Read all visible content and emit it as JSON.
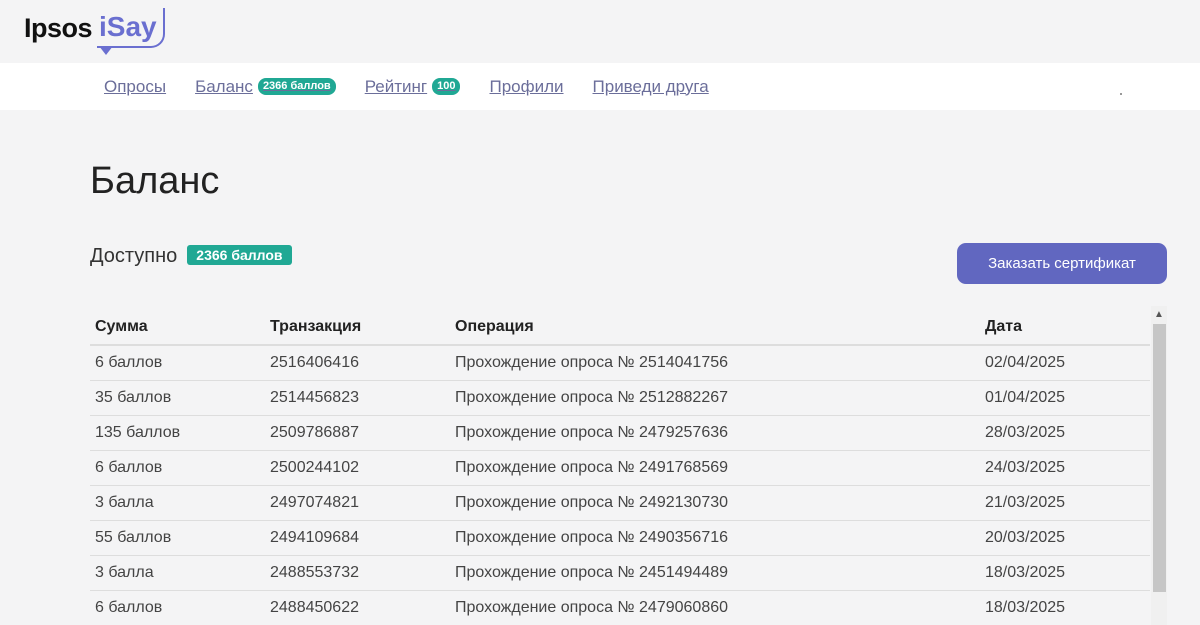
{
  "logo": {
    "brand": "Ipsos",
    "product": "iSay"
  },
  "nav": {
    "surveys": "Опросы",
    "balance": "Баланс",
    "balance_badge": "2366 баллов",
    "rating": "Рейтинг",
    "rating_badge": "100",
    "profiles": "Профили",
    "invite": "Приведи друга"
  },
  "page": {
    "title": "Баланс",
    "available_label": "Доступно",
    "available_badge": "2366 баллов",
    "cert_button": "Заказать сертификат"
  },
  "table": {
    "headers": [
      "Сумма",
      "Транзакция",
      "Операция",
      "Дата"
    ],
    "rows": [
      [
        "6 баллов",
        "2516406416",
        "Прохождение опроса № 2514041756",
        "02/04/2025"
      ],
      [
        "35 баллов",
        "2514456823",
        "Прохождение опроса № 2512882267",
        "01/04/2025"
      ],
      [
        "135 баллов",
        "2509786887",
        "Прохождение опроса № 2479257636",
        "28/03/2025"
      ],
      [
        "6 баллов",
        "2500244102",
        "Прохождение опроса № 2491768569",
        "24/03/2025"
      ],
      [
        "3 балла",
        "2497074821",
        "Прохождение опроса № 2492130730",
        "21/03/2025"
      ],
      [
        "55 баллов",
        "2494109684",
        "Прохождение опроса № 2490356716",
        "20/03/2025"
      ],
      [
        "3 балла",
        "2488553732",
        "Прохождение опроса № 2451494489",
        "18/03/2025"
      ],
      [
        "6 баллов",
        "2488450622",
        "Прохождение опроса № 2479060860",
        "18/03/2025"
      ]
    ]
  },
  "colors": {
    "accent": "#6167c0",
    "badge": "#20a894",
    "nav_link": "#6b6e9a"
  },
  "icons": {
    "scroll_up": "chevron-up-icon"
  }
}
